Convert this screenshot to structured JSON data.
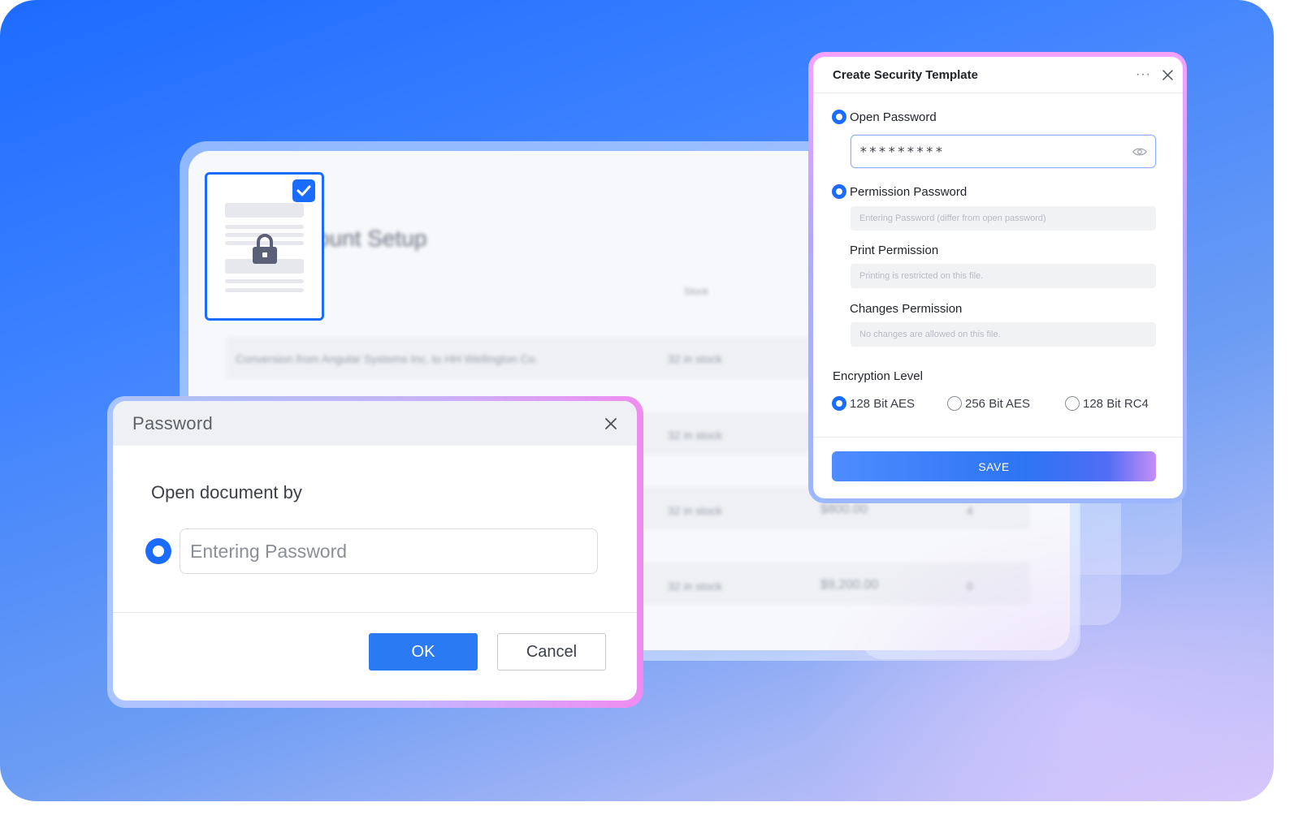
{
  "background_window": {
    "title_partial": "ount Setup",
    "column_header": "Stock",
    "rows": [
      {
        "description": "Conversion from Angular Systems Inc. to HH Wellington Co.",
        "stock": "32 in stock",
        "price": "",
        "qty": ""
      },
      {
        "description": "",
        "stock": "32 in stock",
        "price": "",
        "qty": ""
      },
      {
        "description": "",
        "stock": "32 in stock",
        "price": "$800.00",
        "qty": "4"
      },
      {
        "description": "",
        "stock": "32 in stock",
        "price": "$9,200.00",
        "qty": "0"
      }
    ]
  },
  "password_dialog": {
    "title": "Password",
    "subtitle": "Open document by",
    "input_placeholder": "Entering Password",
    "ok_label": "OK",
    "cancel_label": "Cancel"
  },
  "security_template": {
    "title": "Create Security Template",
    "more_icon": "ellipsis-icon",
    "close_icon": "close-icon",
    "open_password": {
      "label": "Open Password",
      "value": "*********"
    },
    "permission_password": {
      "label": "Permission Password",
      "placeholder": "Entering Password (differ from open password)"
    },
    "print_permission": {
      "label": "Print Permission",
      "value": "Printing is restricted on this file."
    },
    "changes_permission": {
      "label": "Changes Permission",
      "value": "No changes are allowed on this file."
    },
    "encryption": {
      "label": "Encryption Level",
      "options": [
        "128 Bit AES",
        "256 Bit AES",
        "128 Bit RC4"
      ],
      "selected": "128 Bit AES"
    },
    "save_label": "SAVE"
  },
  "colors": {
    "accent": "#1a6cff",
    "button_blue": "#2a7af3"
  }
}
